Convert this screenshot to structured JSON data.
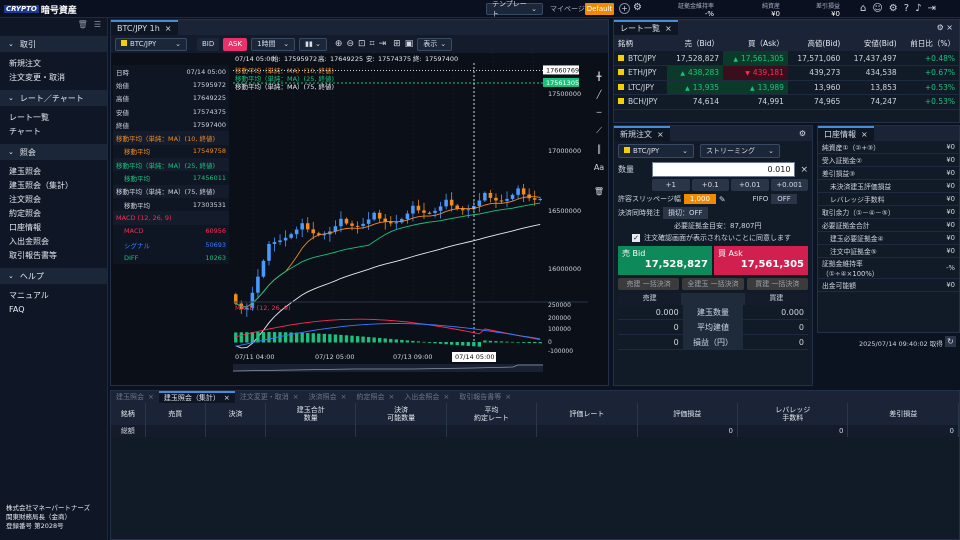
{
  "header": {
    "logo": "CRYPTO",
    "app_title": "暗号資産",
    "template_label": "テンプレート",
    "mypage_label": "マイページ",
    "default_label": "Default",
    "metrics": [
      {
        "label": "証拠金維持率",
        "value": "-%"
      },
      {
        "label": "純資産",
        "value": "¥0"
      },
      {
        "label": "差引損益",
        "value": "¥0"
      }
    ]
  },
  "sidebar": {
    "sections": [
      {
        "title": "取引",
        "items": [
          "新規注文",
          "注文変更・取消"
        ]
      },
      {
        "title": "レート／チャート",
        "items": [
          "レート一覧",
          "チャート"
        ]
      },
      {
        "title": "照会",
        "items": [
          "建玉照会",
          "建玉照会（集計）",
          "注文照会",
          "約定照会",
          "口座情報",
          "入出金照会",
          "取引報告書等"
        ]
      },
      {
        "title": "ヘルプ",
        "items": [
          "マニュアル",
          "FAQ"
        ]
      }
    ],
    "footer": [
      "株式会社マネーパートナーズ",
      "関東財務局長（金商）",
      "登録番号 第2028号"
    ]
  },
  "chart": {
    "tab": "BTC/JPY 1h",
    "symbol": "BTC/JPY",
    "bid_label": "BID",
    "ask_label": "ASK",
    "interval": "1時間",
    "display_label": "表示",
    "ohlc": {
      "date": "07/14 05:00",
      "open_label": "始:",
      "open": "17595972",
      "high_label": "高:",
      "high": "17649225",
      "low_label": "安:",
      "low": "17574375",
      "close_label": "終:",
      "close": "17597400"
    },
    "ma_labels": [
      "移動平均（単純：MA）(10, 終値)",
      "移動平均（単純：MA）(25, 終値)",
      "移動平均（単純：MA）(75, 終値)"
    ],
    "macd_label": "MACD (12, 26, 9)",
    "price_axis": [
      "17500000",
      "17000000",
      "16500000",
      "16000000"
    ],
    "price_flag_top": "17660769",
    "price_flag_mid": "17561305",
    "macd_axis": [
      "250000",
      "200000",
      "100000",
      "0",
      "-100000"
    ],
    "time_labels": [
      "07/11 04:00",
      "07/12 05:00",
      "07/13 09:00",
      "07/14 05:00"
    ],
    "time_cursor": "07/14 05:00"
  },
  "info": [
    {
      "label": "日時",
      "value": "07/14 05:00",
      "color": ""
    },
    {
      "label": "始値",
      "value": "17595972",
      "color": ""
    },
    {
      "label": "高値",
      "value": "17649225",
      "color": ""
    },
    {
      "label": "安値",
      "value": "17574375",
      "color": ""
    },
    {
      "label": "終値",
      "value": "17597400",
      "color": ""
    },
    {
      "label": "移動平均（単純：MA）(10, 終値)",
      "value": "",
      "color": "#f08a24"
    },
    {
      "label": "移動平均",
      "value": "17549758",
      "color": "#f08a24"
    },
    {
      "label": "移動平均（単純：MA）(25, 終値)",
      "value": "",
      "color": "#19c37d"
    },
    {
      "label": "移動平均",
      "value": "17456011",
      "color": "#19c37d"
    },
    {
      "label": "移動平均（単純：MA）(75, 終値)",
      "value": "",
      "color": ""
    },
    {
      "label": "移動平均",
      "value": "17303531",
      "color": ""
    },
    {
      "label": "MACD (12, 26, 9)",
      "value": "",
      "color": "#ff2a55"
    },
    {
      "label": "MACD",
      "value": "60956",
      "color": "#ff2a55"
    },
    {
      "label": "シグナル",
      "value": "50693",
      "color": "#3b7bff"
    },
    {
      "label": "DIFF",
      "value": "10263",
      "color": "#19c37d"
    }
  ],
  "rates": {
    "title": "レート一覧",
    "headers": [
      "銘柄",
      "売（Bid）",
      "買（Ask）",
      "高値(Bid)",
      "安値(Bid)",
      "前日比（%）"
    ],
    "rows": [
      {
        "symbol": "BTC/JPY",
        "bid": "17,528,827",
        "ask": "17,561,305",
        "high": "17,571,060",
        "low": "17,437,497",
        "change": "+0.48%",
        "bid_dir": "",
        "ask_dir": "up"
      },
      {
        "symbol": "ETH/JPY",
        "bid": "438,283",
        "ask": "439,181",
        "high": "439,273",
        "low": "434,538",
        "change": "+0.67%",
        "bid_dir": "up",
        "ask_dir": "down"
      },
      {
        "symbol": "LTC/JPY",
        "bid": "13,935",
        "ask": "13,989",
        "high": "13,960",
        "low": "13,853",
        "change": "+0.53%",
        "bid_dir": "up",
        "ask_dir": "up"
      },
      {
        "symbol": "BCH/JPY",
        "bid": "74,614",
        "ask": "74,991",
        "high": "74,965",
        "low": "74,247",
        "change": "+0.53%",
        "bid_dir": "",
        "ask_dir": ""
      }
    ]
  },
  "order": {
    "title": "新規注文",
    "symbol": "BTC/JPY",
    "mode": "ストリーミング",
    "qty_label": "数量",
    "qty": "0.010",
    "steps": [
      "+1",
      "+0.1",
      "+0.01",
      "+0.001"
    ],
    "slip_label": "許容スリッページ幅",
    "slip_value": "1,000",
    "fifo_label": "FIFO",
    "fifo_value": "OFF",
    "settle_label": "決済同時発注",
    "settle_value": "損切：OFF",
    "margin_label": "必要証拠金目安：",
    "margin_value": "87,807円",
    "confirm_label": "注文確認画面が表示されないことに同意します",
    "sell_label": "売 Bid",
    "sell_price": "17,528,827",
    "buy_label": "買 Ask",
    "buy_price": "17,561,305",
    "bulk": [
      "売建 一括決済",
      "全建玉 一括決済",
      "買建 一括決済"
    ],
    "pos_headers": [
      "売建",
      "",
      "買建"
    ],
    "pos_rows": [
      {
        "left": "0.000",
        "label": "建玉数量",
        "right": "0.000"
      },
      {
        "left": "0",
        "label": "平均建値",
        "right": "0"
      },
      {
        "left": "0",
        "label": "損益（円）",
        "right": "0"
      }
    ]
  },
  "account": {
    "title": "口座情報",
    "rows": [
      {
        "label": "純資産①（②+③）",
        "value": "¥0",
        "indent": false
      },
      {
        "label": "受入証拠金②",
        "value": "¥0",
        "indent": false
      },
      {
        "label": "差引損益③",
        "value": "¥0",
        "indent": false
      },
      {
        "label": "未決済建玉評価損益",
        "value": "¥0",
        "indent": true
      },
      {
        "label": "レバレッジ手数料",
        "value": "¥0",
        "indent": true
      },
      {
        "label": "取引余力（①－④－⑤）",
        "value": "¥0",
        "indent": false
      },
      {
        "label": "必要証拠金合計",
        "value": "¥0",
        "indent": false
      },
      {
        "label": "建玉必要証拠金④",
        "value": "¥0",
        "indent": true
      },
      {
        "label": "注文中証拠金⑤",
        "value": "¥0",
        "indent": true
      },
      {
        "label": "証拠金維持率（①÷④×100%）",
        "value": "-%",
        "indent": false
      },
      {
        "label": "出金可能額",
        "value": "¥0",
        "indent": false
      }
    ],
    "timestamp": "2025/07/14 09:40:02 取得"
  },
  "bottom": {
    "tabs": [
      "建玉照会",
      "建玉照会（集計）",
      "注文変更・取消",
      "決済照会",
      "約定照会",
      "入出金照会",
      "取引報告書等"
    ],
    "active": 1,
    "headers": [
      [
        "銘柄",
        ""
      ],
      [
        "売買",
        ""
      ],
      [
        "決済",
        ""
      ],
      [
        "建玉合計",
        "数量"
      ],
      [
        "決済",
        "可能数量"
      ],
      [
        "平均",
        "約定レート"
      ],
      [
        "評価レート",
        ""
      ],
      [
        "評価損益",
        ""
      ],
      [
        "レバレッジ",
        "手数料"
      ],
      [
        "差引損益",
        ""
      ]
    ],
    "total_label": "総額",
    "totals": [
      "0",
      "0",
      "0"
    ]
  }
}
